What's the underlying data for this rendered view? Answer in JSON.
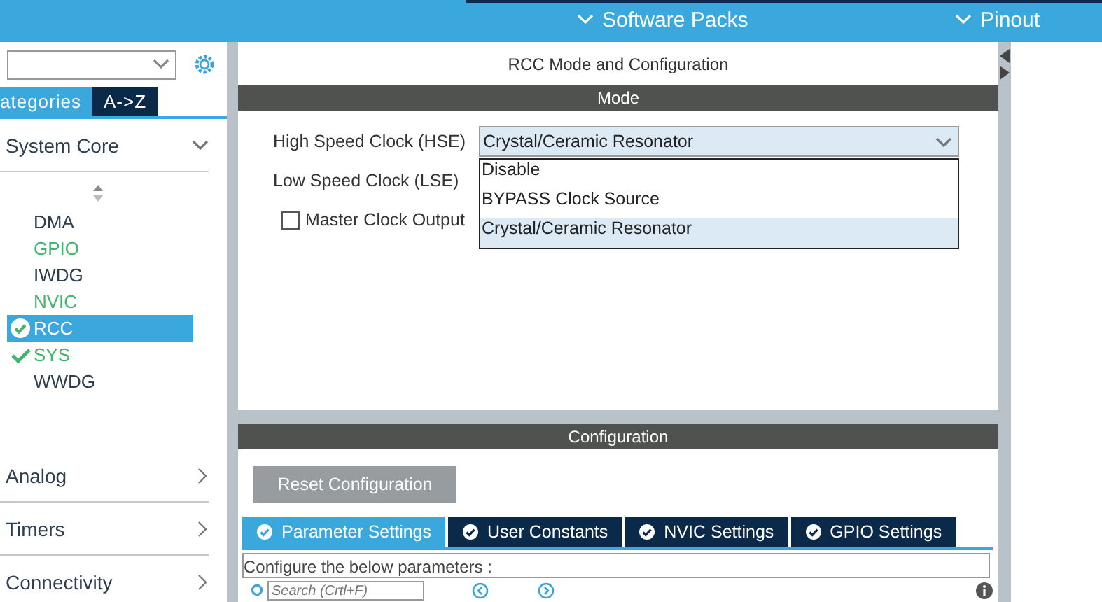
{
  "top_bar": {
    "items": [
      {
        "label": "Software Packs"
      },
      {
        "label": "Pinout"
      }
    ]
  },
  "sidebar": {
    "tabs": [
      {
        "label": "ategories",
        "selected": true
      },
      {
        "label": "A->Z",
        "selected": false
      }
    ],
    "categories": [
      {
        "label": "System Core",
        "expanded": true,
        "children": [
          {
            "label": "DMA",
            "kind": "plain",
            "selected": false
          },
          {
            "label": "GPIO",
            "kind": "enabled",
            "selected": false
          },
          {
            "label": "IWDG",
            "kind": "plain",
            "selected": false
          },
          {
            "label": "NVIC",
            "kind": "enabled",
            "selected": false
          },
          {
            "label": "RCC",
            "kind": "checked",
            "selected": true
          },
          {
            "label": "SYS",
            "kind": "checked",
            "selected": false
          },
          {
            "label": "WWDG",
            "kind": "plain",
            "selected": false
          }
        ]
      },
      {
        "label": "Analog",
        "expanded": false
      },
      {
        "label": "Timers",
        "expanded": false
      },
      {
        "label": "Connectivity",
        "expanded": false
      }
    ]
  },
  "mode": {
    "title": "RCC Mode and Configuration",
    "header": "Mode",
    "fields": [
      {
        "kind": "select",
        "label": "High Speed Clock (HSE)",
        "value": "Crystal/Ceramic Resonator",
        "expanded": true,
        "options": [
          {
            "label": "Disable",
            "selected": false
          },
          {
            "label": "BYPASS Clock Source",
            "selected": false
          },
          {
            "label": "Crystal/Ceramic Resonator",
            "selected": true
          }
        ]
      },
      {
        "kind": "select",
        "label": "Low Speed Clock (LSE)"
      },
      {
        "kind": "checkbox",
        "label": "Master Clock Output",
        "checked": false
      }
    ]
  },
  "configuration": {
    "header": "Configuration",
    "reset_button": "Reset Configuration",
    "tabs": [
      {
        "label": "Parameter Settings",
        "selected": true
      },
      {
        "label": "User Constants",
        "selected": false
      },
      {
        "label": "NVIC Settings",
        "selected": false
      },
      {
        "label": "GPIO Settings",
        "selected": false
      }
    ],
    "description": "Configure the below parameters :",
    "search": {
      "placeholder": "Search (Crtl+F)"
    }
  }
}
